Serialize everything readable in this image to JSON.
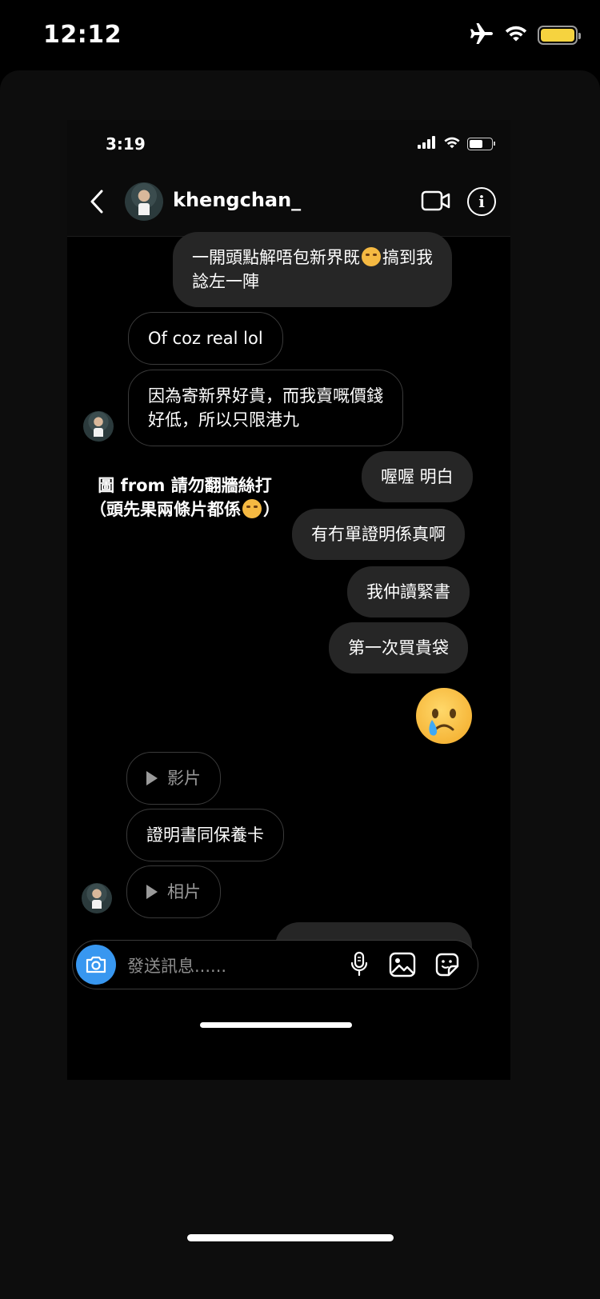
{
  "outer_status": {
    "time": "12:12"
  },
  "inner_status": {
    "time": "3:19"
  },
  "header": {
    "username": "khengchan_"
  },
  "messages": [
    {
      "side": "sent",
      "line1": "一開頭點解唔包新界既",
      "line1b": "搞到我",
      "line2": "諗左一陣"
    },
    {
      "side": "received",
      "text": "Of coz real lol"
    },
    {
      "side": "received",
      "line1": "因為寄新界好貴，而我賣嘅價錢",
      "line2": "好低，所以只限港九"
    },
    {
      "side": "sent",
      "text": "喔喔 明白"
    },
    {
      "side": "sent",
      "text": "有冇單證明係真啊"
    },
    {
      "side": "sent",
      "text": "我仲讀緊書"
    },
    {
      "side": "sent",
      "text": "第一次買貴袋"
    },
    {
      "side": "received",
      "media": "影片"
    },
    {
      "side": "received",
      "text": "證明書同保養卡"
    },
    {
      "side": "received",
      "media": "相片"
    }
  ],
  "caption": {
    "line1": "圖 from 請勿翻牆絲打",
    "line2": "（頭先果兩條片都係"
  },
  "input": {
    "placeholder": "發送訊息......"
  },
  "colors": {
    "accent": "#3897f0",
    "sent_bubble": "#262626",
    "battery": "#f6d33f"
  },
  "icons": [
    "airplane-icon",
    "wifi-icon",
    "battery-icon",
    "signal-icon",
    "back-icon",
    "video-call-icon",
    "info-icon",
    "camera-icon",
    "microphone-icon",
    "gallery-icon",
    "sticker-icon",
    "crying-face-emoji",
    "laughing-emoji",
    "persevering-face-emoji"
  ]
}
